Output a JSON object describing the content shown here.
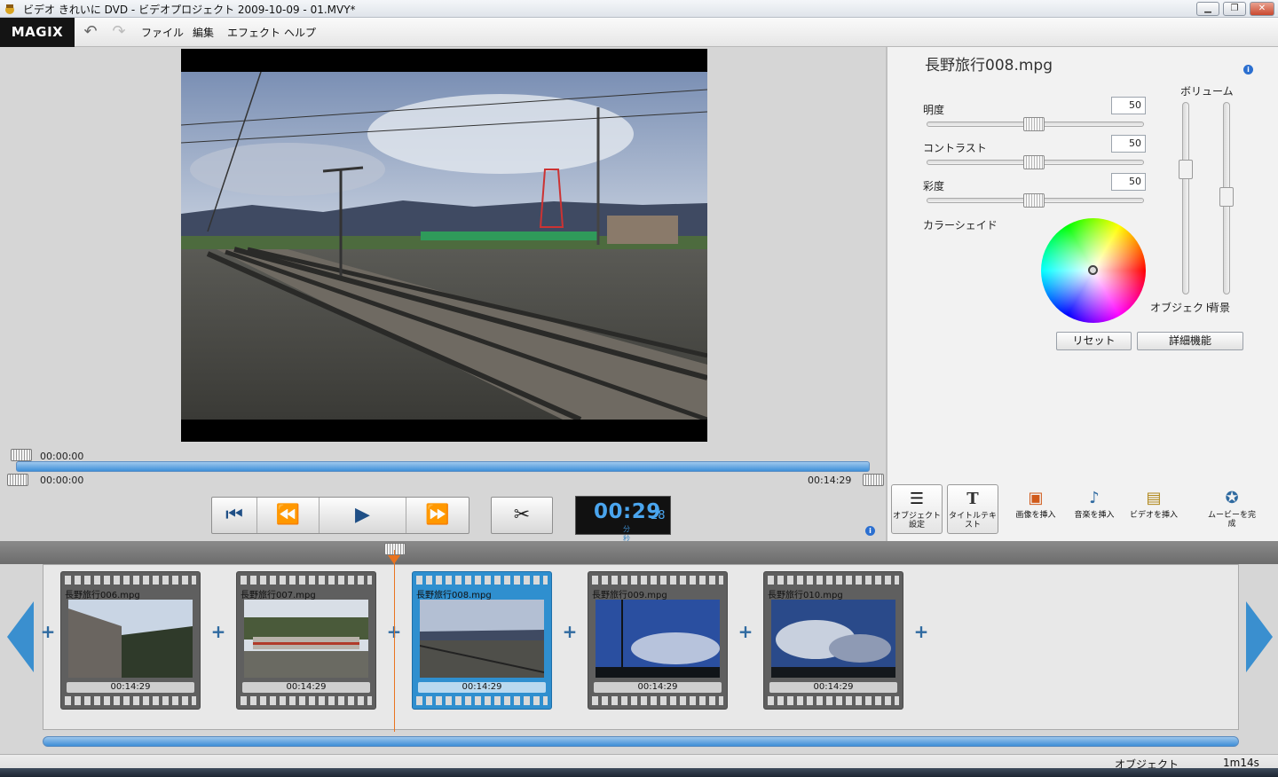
{
  "window": {
    "title": "ビデオ きれいに DVD  - ビデオプロジェクト 2009-10-09 - 01.MVY*",
    "minimize_icon": "minimize-icon",
    "maximize_icon": "restore-icon",
    "close_icon": "close-icon"
  },
  "menubar": {
    "logo": "MAGIX",
    "items": [
      "ファイル",
      "編集",
      "エフェクト",
      "ヘルプ"
    ]
  },
  "preview": {
    "in_time": "00:00:00",
    "start_time": "00:00:00",
    "end_time": "00:14:29"
  },
  "counter": {
    "time": "00:29",
    "frames": "28",
    "units": "分 秒 fr"
  },
  "properties": {
    "object_name": "長野旅行008.mpg",
    "brightness_label": "明度",
    "brightness_value": "50",
    "contrast_label": "コントラスト",
    "contrast_value": "50",
    "saturation_label": "彩度",
    "saturation_value": "50",
    "color_shade_label": "カラーシェイド",
    "volume_label": "ボリューム",
    "object_label": "オブジェクト",
    "background_label": "背景",
    "reset_button": "リセット",
    "advanced_button": "詳細機能"
  },
  "tools": [
    {
      "label": "オブジェクト設定",
      "icon": "sliders-icon"
    },
    {
      "label": "タイトルテキスト",
      "icon": "title-text-icon"
    },
    {
      "label": "画像を挿入",
      "icon": "insert-image-icon"
    },
    {
      "label": "音楽を挿入",
      "icon": "insert-music-icon"
    },
    {
      "label": "ビデオを挿入",
      "icon": "insert-video-icon"
    },
    {
      "label": "ムービーを完成",
      "icon": "finish-movie-icon"
    }
  ],
  "clips": [
    {
      "name": "長野旅行006.mpg",
      "duration": "00:14:29"
    },
    {
      "name": "長野旅行007.mpg",
      "duration": "00:14:29"
    },
    {
      "name": "長野旅行008.mpg",
      "duration": "00:14:29"
    },
    {
      "name": "長野旅行009.mpg",
      "duration": "00:14:29"
    },
    {
      "name": "長野旅行010.mpg",
      "duration": "00:14:29"
    }
  ],
  "status": {
    "mode": "オブジェクト",
    "total": "1m14s"
  },
  "colors": {
    "accent_blue": "#3d8fd8",
    "playhead_orange": "#e9731f",
    "selected_clip": "#2f8fcf"
  }
}
